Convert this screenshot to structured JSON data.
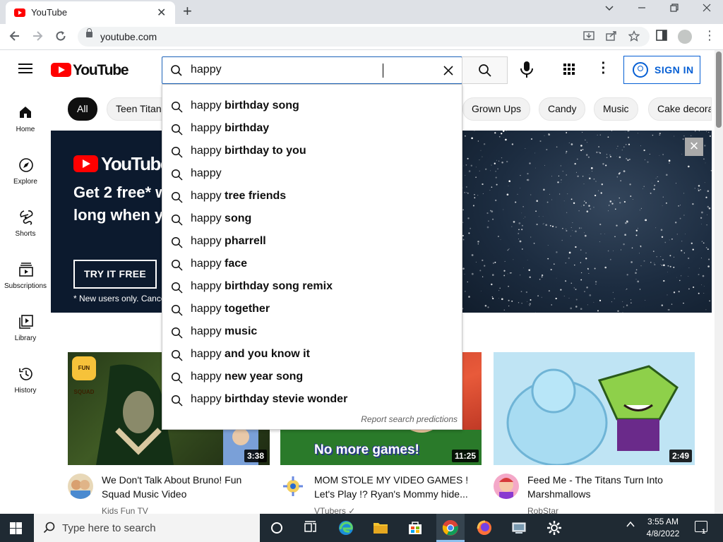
{
  "browser": {
    "tab_title": "YouTube",
    "tab_close": "✕",
    "new_tab": "+",
    "url": "youtube.com",
    "window_controls": [
      "minimize",
      "maximize",
      "close"
    ]
  },
  "header": {
    "logo_text": "YouTube",
    "search_value": "happy",
    "clear_glyph": "✕",
    "signin_label": "SIGN IN"
  },
  "sidebar": {
    "items": [
      {
        "label": "Home",
        "icon": "home-icon"
      },
      {
        "label": "Explore",
        "icon": "compass-icon"
      },
      {
        "label": "Shorts",
        "icon": "shorts-icon"
      },
      {
        "label": "Subscriptions",
        "icon": "subscriptions-icon"
      },
      {
        "label": "Library",
        "icon": "library-icon"
      },
      {
        "label": "History",
        "icon": "history-icon"
      }
    ]
  },
  "chips": [
    "All",
    "Teen Titan",
    "Grown Ups",
    "Candy",
    "Music",
    "Cake decora"
  ],
  "banner": {
    "logo_text": "YouTubeTV",
    "headline_1": "Get 2 free* w",
    "headline_2": "long when y",
    "cta": "TRY IT FREE",
    "fine_print": "* New users only. Cance",
    "close_glyph": "×"
  },
  "suggestions": {
    "query": "happy",
    "items": [
      {
        "prefix": "happy",
        "rest": " birthday song"
      },
      {
        "prefix": "happy",
        "rest": " birthday"
      },
      {
        "prefix": "happy",
        "rest": " birthday to you"
      },
      {
        "prefix": "happy",
        "rest": ""
      },
      {
        "prefix": "happy",
        "rest": " tree friends"
      },
      {
        "prefix": "happy",
        "rest": " song"
      },
      {
        "prefix": "happy",
        "rest": " pharrell"
      },
      {
        "prefix": "happy",
        "rest": " face"
      },
      {
        "prefix": "happy",
        "rest": " birthday song remix"
      },
      {
        "prefix": "happy",
        "rest": " together"
      },
      {
        "prefix": "happy",
        "rest": " music"
      },
      {
        "prefix": "happy",
        "rest": " and you know it"
      },
      {
        "prefix": "happy",
        "rest": " new year song"
      },
      {
        "prefix": "happy",
        "rest": " birthday stevie wonder"
      }
    ],
    "report_label": "Report search predictions"
  },
  "videos": [
    {
      "title": "We Don't Talk About Bruno! Fun Squad Music Video",
      "channel": "Kids Fun TV",
      "duration": "3:38",
      "thumb_text": "FUN SQUAD"
    },
    {
      "title": "MOM STOLE MY VIDEO GAMES ! Let's Play !? Ryan's Mommy hide...",
      "channel": "VTubers ✓",
      "duration": "11:25",
      "thumb_text": "No more games!"
    },
    {
      "title": "Feed Me - The Titans Turn Into Marshmallows",
      "channel": "RobStar",
      "duration": "2:49",
      "thumb_text": ""
    }
  ],
  "taskbar": {
    "search_placeholder": "Type here to search",
    "time": "3:55 AM",
    "date": "4/8/2022",
    "notification_count": "1",
    "icons": [
      "task-view-icon",
      "timeline-icon",
      "edge-icon",
      "file-explorer-icon",
      "store-icon",
      "chrome-icon",
      "firefox-icon",
      "network-drive-icon",
      "settings-icon"
    ]
  },
  "colors": {
    "brand_red": "#ff0000",
    "link_blue": "#065fd4",
    "search_border": "#1c62b9",
    "taskbar": "#1f2a33"
  }
}
